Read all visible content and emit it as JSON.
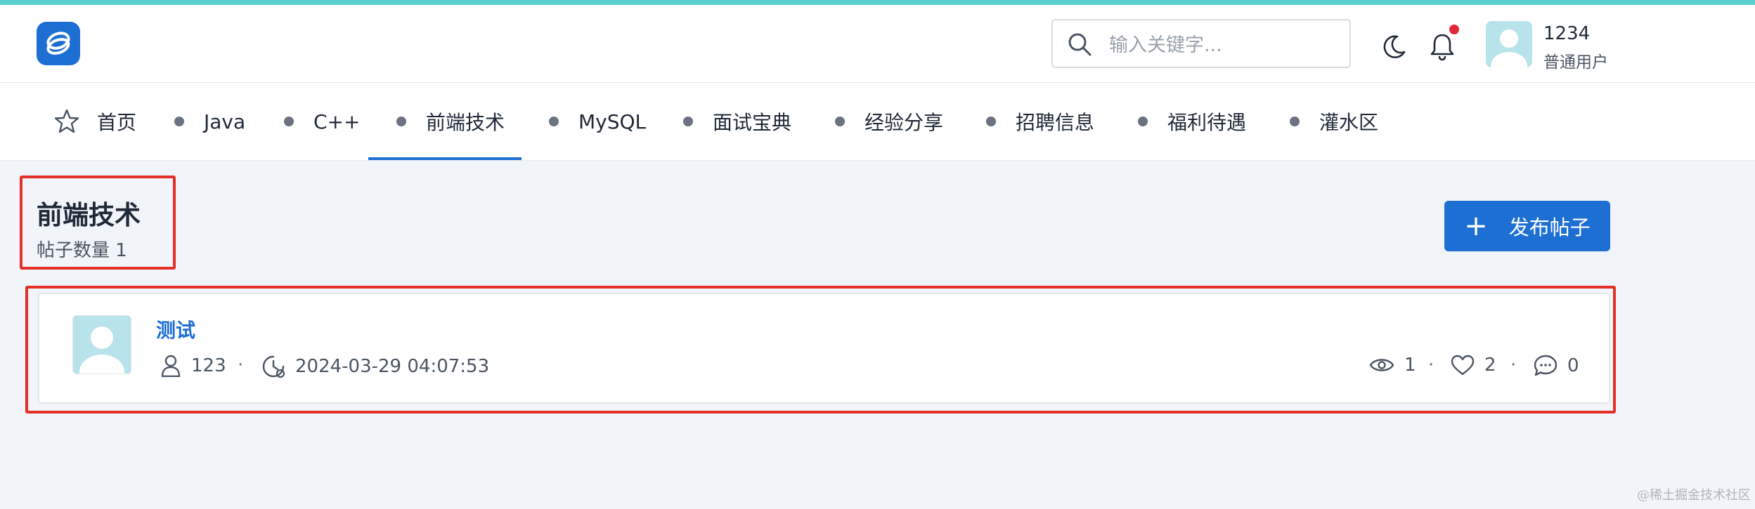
{
  "header": {
    "search_placeholder": "输入关键字...",
    "user_name": "1234",
    "user_role": "普通用户"
  },
  "nav": {
    "items": [
      {
        "label": "首页"
      },
      {
        "label": "Java"
      },
      {
        "label": "C++"
      },
      {
        "label": "前端技术"
      },
      {
        "label": "MySQL"
      },
      {
        "label": "面试宝典"
      },
      {
        "label": "经验分享"
      },
      {
        "label": "招聘信息"
      },
      {
        "label": "福利待遇"
      },
      {
        "label": "灌水区"
      }
    ],
    "active": "前端技术"
  },
  "section": {
    "title": "前端技术",
    "count_text": "帖子数量 1",
    "publish_label": "发布帖子"
  },
  "posts": [
    {
      "title": "测试",
      "author": "123",
      "time": "2024-03-29 04:07:53",
      "views": "1",
      "likes": "2",
      "comments": "0"
    }
  ],
  "colors": {
    "accent": "#1e6fd4",
    "top_bar": "#5ccfcf",
    "highlight_box": "#e33028",
    "notification_dot": "#e0283a"
  },
  "watermark": "@稀土掘金技术社区"
}
